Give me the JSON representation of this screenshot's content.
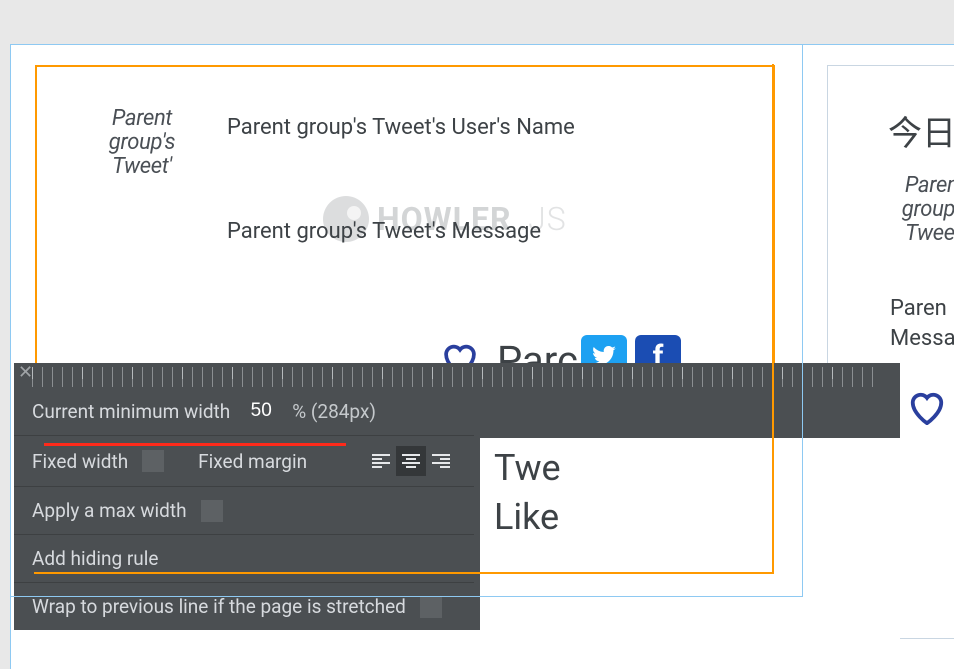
{
  "card1": {
    "avatar_placeholder": "Parent group's Tweet'",
    "user_name": "Parent group's Tweet's User's Name",
    "message": "Parent group's Tweet's Message",
    "watermark_main": "HOWLER",
    "watermark_suffix": ".JS",
    "like_partial": "Parc",
    "below_text_1": "Twe",
    "below_text_2": "Like"
  },
  "card2": {
    "title": "今日",
    "avatar_placeholder": "Parent group's Tweet'",
    "user_name_partial": "Paren",
    "message_partial": "Messa"
  },
  "panel": {
    "min_width_label": "Current minimum width",
    "min_width_value": "50",
    "min_width_unit": "%",
    "min_width_px": "(284px)",
    "fixed_width_label": "Fixed width",
    "fixed_margin_label": "Fixed margin",
    "max_width_label": "Apply a max width",
    "hiding_rule_label": "Add hiding rule",
    "wrap_label": "Wrap to previous line if the page is stretched"
  },
  "icons": {
    "heart": "heart-outline",
    "twitter": "twitter-bird",
    "facebook_letter": "f"
  },
  "colors": {
    "selection_orange": "#ff9900",
    "selection_blue": "#8ec9f2",
    "panel_bg": "#4b4f52",
    "twitter": "#1da1f2",
    "facebook": "#1b4db3",
    "annotation_red": "#ff2a1a"
  }
}
